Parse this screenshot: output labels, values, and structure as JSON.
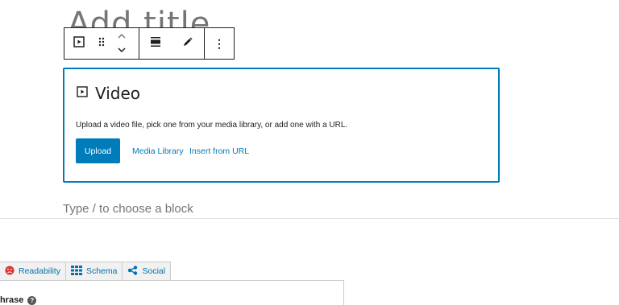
{
  "editor": {
    "title_placeholder": "Add title",
    "type_prompt": "Type / to choose a block"
  },
  "toolbar": {
    "icons": [
      "video-block-icon",
      "drag-handle-icon",
      "move-up-icon",
      "move-down-icon",
      "align-icon",
      "edit-icon",
      "more-options-icon"
    ],
    "more_label": "⋮"
  },
  "video_block": {
    "label": "Video",
    "instructions": "Upload a video file, pick one from your media library, or add one with a URL.",
    "upload_label": "Upload",
    "media_library_label": "Media Library",
    "insert_url_label": "Insert from URL",
    "accent": "#007cba"
  },
  "seo_panel": {
    "tabs": [
      {
        "label": "Readability",
        "icon": "sad-face-icon",
        "color": "#dc3232"
      },
      {
        "label": "Schema",
        "icon": "grid-icon"
      },
      {
        "label": "Social",
        "icon": "share-icon"
      }
    ],
    "keyphrase_label": "hrase",
    "help_glyph": "?"
  }
}
